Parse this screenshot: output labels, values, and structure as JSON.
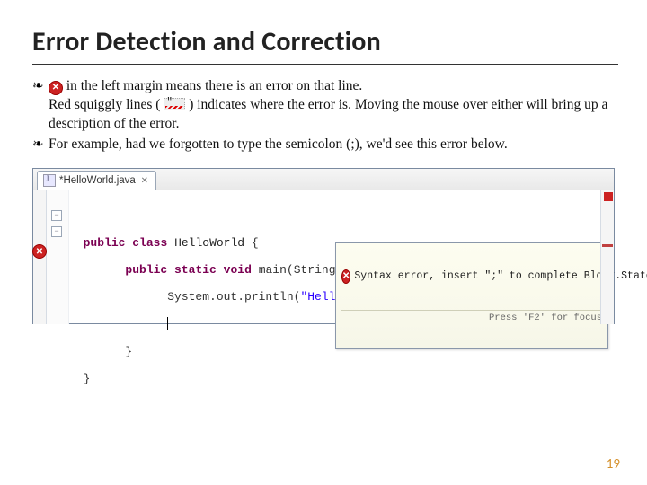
{
  "title": "Error Detection and Correction",
  "bullets": {
    "b1a": "in the left margin means there is an error on that line.",
    "b1b_before": "Red squiggly lines (",
    "b1b_after": ") indicates where the error is. Moving the mouse over either will bring up a description of the error.",
    "b2": "For example, had we forgotten to type the semicolon (;), we'd see this error below."
  },
  "ide": {
    "tab": {
      "filename": "*HelloWorld.java",
      "close": "✕"
    },
    "code": {
      "l2_kw1": "public",
      "l2_kw2": "class",
      "l2_cls": "HelloWorld",
      "l2_brace": "{",
      "l3_kw1": "public",
      "l3_kw2": "static",
      "l3_kw3": "void",
      "l3_m": "main(String[] args) {",
      "l4_pre": "System.out.println(",
      "l4_str": "\"Hello World!\"",
      "l4_post": ")",
      "l6": "}",
      "l7": "}"
    },
    "fold": "−",
    "tooltip": {
      "msg": "Syntax error, insert \";\" to complete Block.Statements",
      "hint": "Press 'F2' for focus"
    }
  },
  "page": "19"
}
